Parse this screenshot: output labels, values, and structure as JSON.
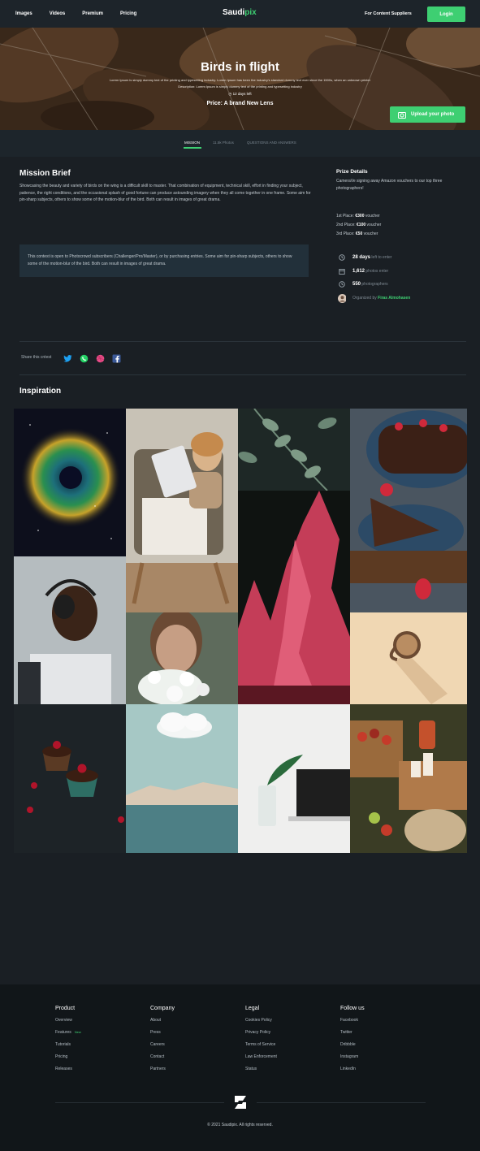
{
  "nav": {
    "links": [
      "Images",
      "Videos",
      "Premium",
      "Pricing"
    ],
    "logo_main": "Saudi",
    "logo_accent": "pix",
    "suppliers": "For Content Suppliers",
    "login": "Login"
  },
  "hero": {
    "title": "Birds in flight",
    "description_1": "Lorem Ipsum is simply dummy text of the printing and typesetting industry. Lorem Ipsum has been the industry's standard dummy text ever since the 1500s, when an unknown printer",
    "description_2": "Description: Lorem Ipsum is simply dummy text of the printing and typesetting industry",
    "days_left": "12 days left",
    "prize": "Price: A brand New Lens",
    "upload": "Upload your photo"
  },
  "tabs": [
    "MISSION",
    "11.5k Photos",
    "QUESTIONS AND ANSWERS"
  ],
  "brief": {
    "heading": "Mission Brief",
    "text": "Showcasing the beauty and variety of birds on the wing is a difficult skill to master. That combination of equipment, technical skill, effort in finding your subject, patience, the right conditions, and the occasional splash of good fortune can produce astounding imagery when they all come together in one frame. Some aim for pin-sharp subjects, others to show some of the motion-blur of the bird. Both can result in images of great drama.",
    "box_text": "This contest is open to Photocrowd subscribers (Challenger/Pro/Master), or by purchasing entries. Some aim for pin-sharp subjects, others to show some of the motion-blur of the bird. Both can result in images of great drama."
  },
  "prize_details": {
    "heading": "Prize Details",
    "text": "CameraVe signing away Amazon vouchers to our top three photographers!",
    "places": [
      {
        "label": "1st Place:",
        "amount": "€300",
        "suffix": "voucher"
      },
      {
        "label": "2nd Place:",
        "amount": "€100",
        "suffix": "voucher"
      },
      {
        "label": "3rd Place:",
        "amount": "€50",
        "suffix": "voucher"
      }
    ],
    "stats": [
      {
        "value": "28 days",
        "label": "left to enter",
        "icon": "clock-icon"
      },
      {
        "value": "1,612",
        "label": "photos enter",
        "icon": "calendar-icon"
      },
      {
        "value": "550",
        "label": "photographers",
        "icon": "clock-icon"
      }
    ],
    "organized_label": "Organized by",
    "organizer": "Firas Almohasen"
  },
  "share": {
    "label": "Share this cntest",
    "icons": [
      "twitter-icon",
      "whatsapp-icon",
      "dribbble-icon",
      "facebook-icon"
    ]
  },
  "inspiration": {
    "heading": "Inspiration",
    "tiles": [
      "nebula",
      "child-with-tablet",
      "eucalyptus-leaves",
      "chocolate-cake",
      "man-with-headphones",
      "woman-with-flowers",
      "red-trees",
      "coffee-cup",
      "cupcakes-with-cherries",
      "sea-and-cloud",
      "laptop-and-plant",
      "picnic-basket"
    ]
  },
  "footer": {
    "columns": [
      {
        "heading": "Product",
        "items": [
          "Overview",
          "Features",
          "Tutorials",
          "Pricing",
          "Releases"
        ],
        "badge": "New"
      },
      {
        "heading": "Company",
        "items": [
          "About",
          "Press",
          "Careers",
          "Contact",
          "Partners"
        ]
      },
      {
        "heading": "Legal",
        "items": [
          "Cookies Policy",
          "Privacy Policy",
          "Terms of Service",
          "Law Enforcement",
          "Status"
        ]
      },
      {
        "heading": "Follow us",
        "items": [
          "Facebook",
          "Twitter",
          "Dribbble",
          "Instagram",
          "LinkedIn"
        ]
      }
    ],
    "copyright": "© 2021 Saudipix. All rights reserved."
  },
  "colors": {
    "accent": "#3ecf72",
    "background": "#1a1f24",
    "panel": "#22303a",
    "footer": "#111619"
  }
}
